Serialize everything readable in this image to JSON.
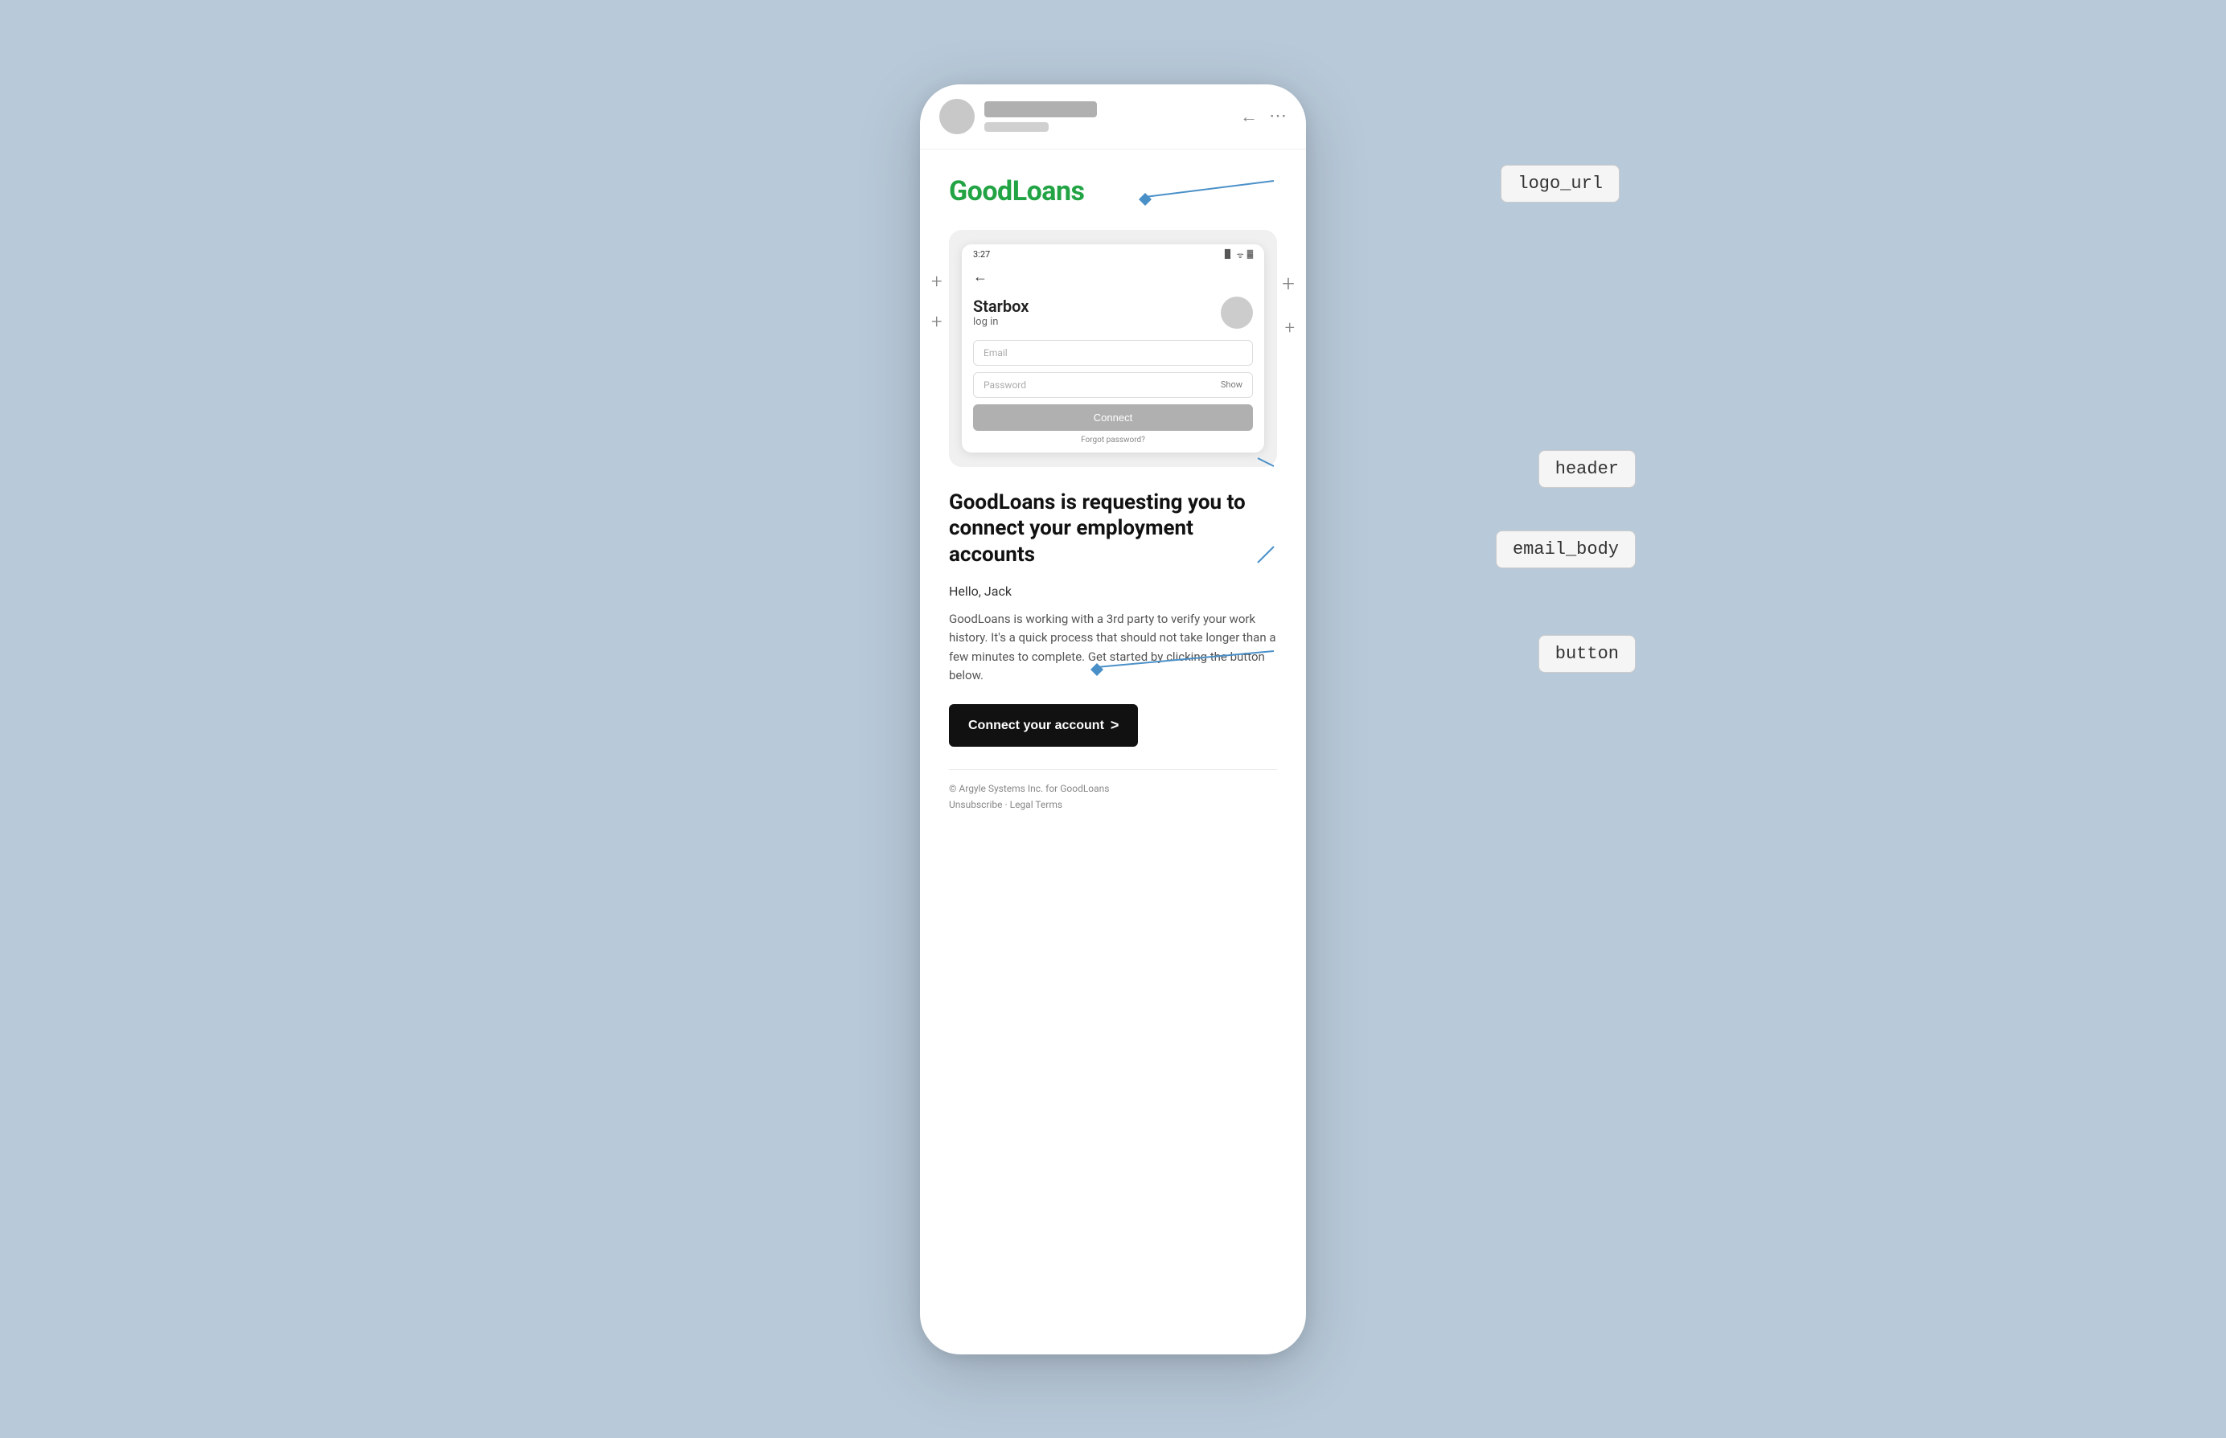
{
  "background_color": "#b8c9d9",
  "phone": {
    "topbar": {
      "back_icon": "←",
      "more_icon": "⋯"
    },
    "logo": {
      "text_good": "Good",
      "text_loans": "Loans",
      "full_text": "GoodLoans"
    },
    "inner_phone": {
      "status_time": "3:27",
      "status_icons": "▐▌ ᯤ 🔋",
      "back_arrow": "←",
      "company_name": "Starbox",
      "login_label": "log in",
      "email_placeholder": "Email",
      "password_placeholder": "Password",
      "show_label": "Show",
      "connect_btn_label": "Connect",
      "forgot_label": "Forgot password?"
    },
    "plus_icons": [
      "+",
      "+",
      "+",
      "+"
    ],
    "email": {
      "header": "GoodLoans is requesting you to connect your employment accounts",
      "greeting": "Hello, Jack",
      "body": "GoodLoans is working with a 3rd party to verify your work history. It's a quick process that should not take longer than a few minutes to complete. Get started by clicking the button below.",
      "button_label": "Connect your account",
      "button_arrow": ">",
      "footer_copyright": "© Argyle Systems Inc. for GoodLoans",
      "footer_links": "Unsubscribe · Legal Terms"
    }
  },
  "annotations": {
    "logo_url": "logo_url",
    "header": "header",
    "email_body": "email_body",
    "button": "button"
  }
}
